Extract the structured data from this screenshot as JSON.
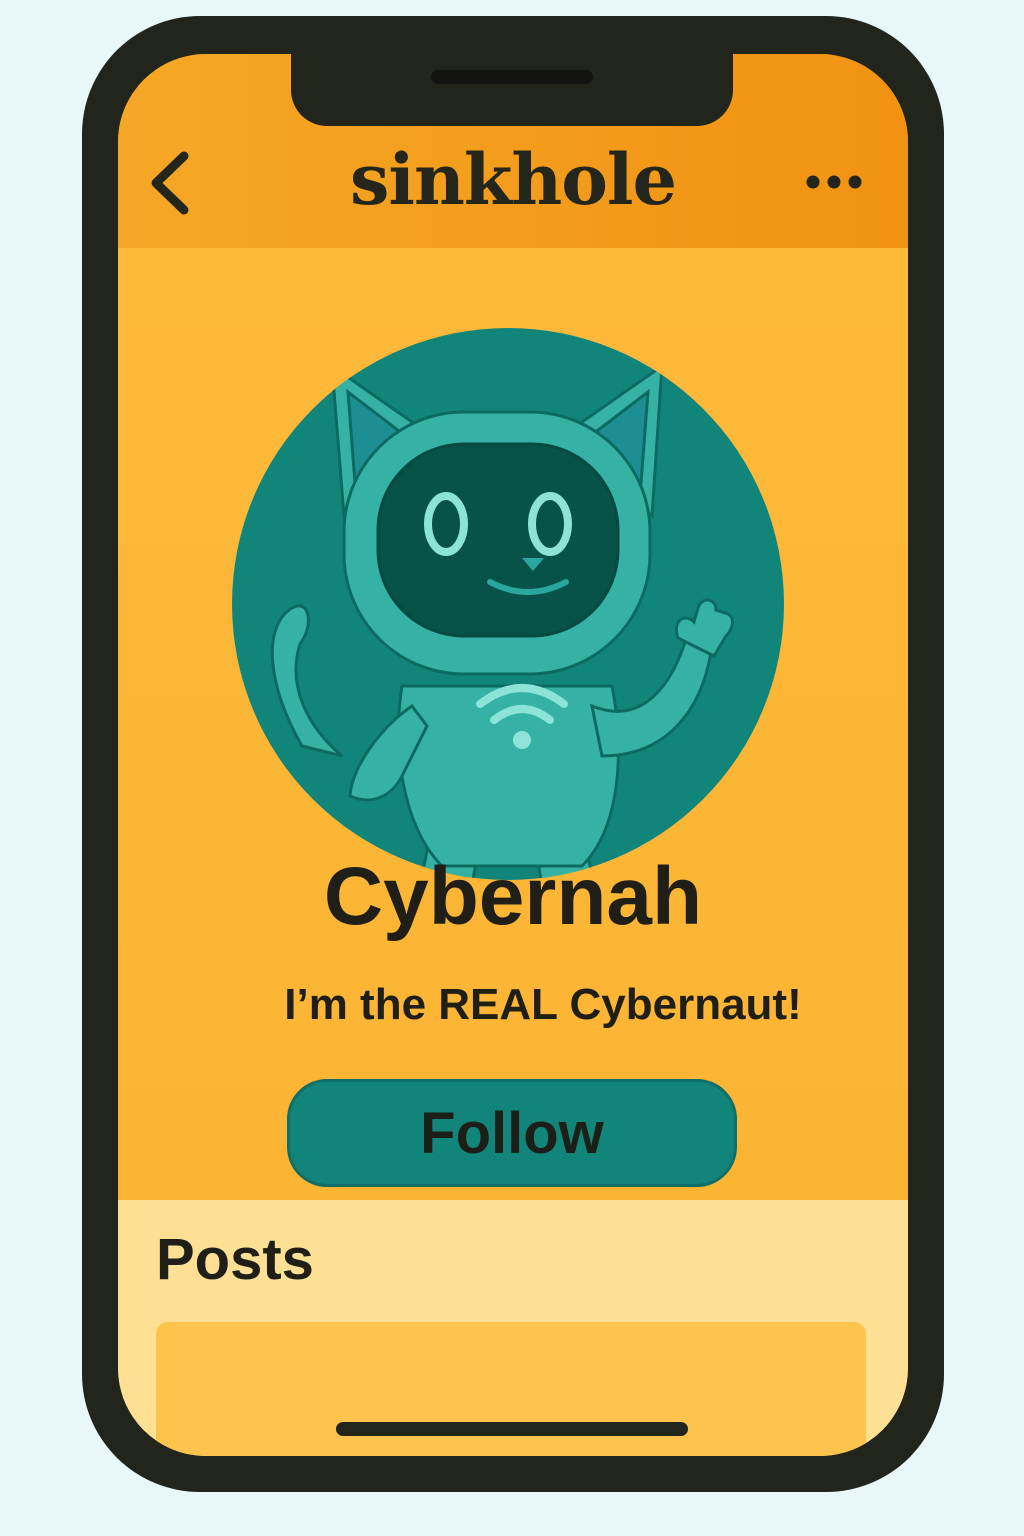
{
  "app": {
    "title": "sinkhole"
  },
  "header": {
    "back_icon": "chevron-left-icon",
    "more_icon": "more-horizontal-icon"
  },
  "profile": {
    "avatar": "robot-cat-avatar",
    "display_name": "Cybernah",
    "bio": "I’m the REAL Cybernaut!",
    "follow_label": "Follow"
  },
  "posts": {
    "heading": "Posts"
  },
  "colors": {
    "header": "#f4a01f",
    "profile_bg": "#fdb934",
    "posts_bg": "#fde094",
    "accent": "#12857a",
    "text": "#1f1f18"
  }
}
